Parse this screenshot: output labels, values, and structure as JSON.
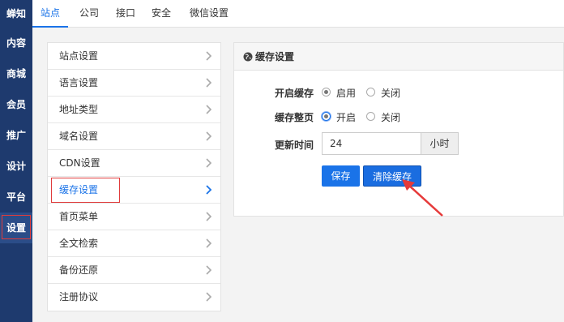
{
  "sidebar": {
    "logo": "蝉知",
    "items": [
      {
        "label": "内容"
      },
      {
        "label": "商城"
      },
      {
        "label": "会员"
      },
      {
        "label": "推广"
      },
      {
        "label": "设计"
      },
      {
        "label": "平台"
      },
      {
        "label": "设置"
      }
    ],
    "active": "设置"
  },
  "tabs": [
    {
      "label": "站点"
    },
    {
      "label": "公司"
    },
    {
      "label": "接口"
    },
    {
      "label": "安全"
    },
    {
      "label": "微信设置"
    }
  ],
  "active_tab": "站点",
  "menu": {
    "items": [
      {
        "label": "站点设置"
      },
      {
        "label": "语言设置"
      },
      {
        "label": "地址类型"
      },
      {
        "label": "域名设置"
      },
      {
        "label": "CDN设置"
      },
      {
        "label": "缓存设置"
      },
      {
        "label": "首页菜单"
      },
      {
        "label": "全文检索"
      },
      {
        "label": "备份还原"
      },
      {
        "label": "注册协议"
      }
    ],
    "active": "缓存设置"
  },
  "panel": {
    "title": "缓存设置",
    "enable_cache_label": "开启缓存",
    "enable_option_on": "启用",
    "enable_option_off": "关闭",
    "enable_cache_value": "启用",
    "page_cache_label": "缓存整页",
    "page_option_on": "开启",
    "page_option_off": "关闭",
    "page_cache_value": "开启",
    "update_time_label": "更新时间",
    "update_time_value": "24",
    "update_time_unit": "小时",
    "save_label": "保存",
    "clear_label": "清除缓存"
  },
  "colors": {
    "sidebar_bg": "#1e3a6e",
    "accent": "#1a73e8",
    "highlight": "#e03c3c"
  }
}
